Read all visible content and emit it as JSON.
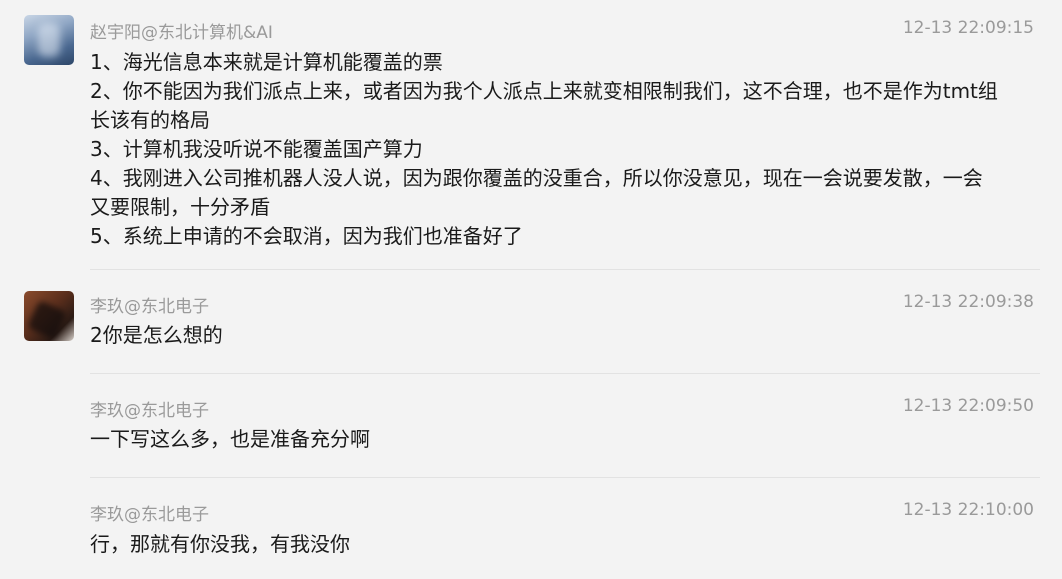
{
  "messages": [
    {
      "sender": "赵宇阳@东北计算机&AI",
      "time": "12-13 22:09:15",
      "lines": [
        "1、海光信息本来就是计算机能覆盖的票",
        "2、你不能因为我们派点上来，或者因为我个人派点上来就变相限制我们，这不合理，也不是作为tmt组",
        "长该有的格局",
        "3、计算机我没听说不能覆盖国产算力",
        "4、我刚进入公司推机器人没人说，因为跟你覆盖的没重合，所以你没意见，现在一会说要发散，一会",
        "又要限制，十分矛盾",
        "5、系统上申请的不会取消，因为我们也准备好了"
      ]
    },
    {
      "sender": "李玖@东北电子",
      "time": "12-13 22:09:38",
      "lines": [
        "2你是怎么想的"
      ]
    },
    {
      "sender": "李玖@东北电子",
      "time": "12-13 22:09:50",
      "lines": [
        "一下写这么多，也是准备充分啊"
      ]
    },
    {
      "sender": "李玖@东北电子",
      "time": "12-13 22:10:00",
      "lines": [
        "行，那就有你没我，有我没你"
      ]
    }
  ]
}
